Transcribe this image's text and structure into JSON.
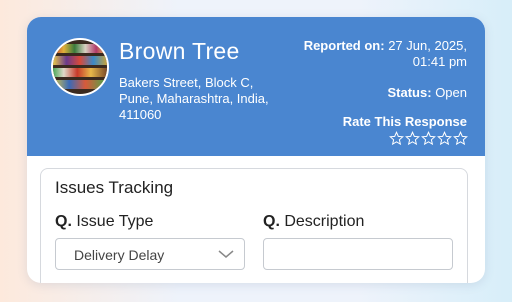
{
  "report": {
    "store_name": "Brown Tree",
    "address": "Bakers Street, Block C, Pune, Maharashtra, India, 411060",
    "reported_on_label": "Reported on:",
    "reported_on_value": "27 Jun, 2025, 01:41 pm",
    "status_label": "Status:",
    "status_value": "Open",
    "rate_label": "Rate This Response",
    "rating": 0,
    "rating_max": 5
  },
  "issues": {
    "title": "Issues Tracking",
    "q_prefix": "Q.",
    "issue_type_label": "Issue Type",
    "issue_type_value": "Delivery Delay",
    "description_label": "Description",
    "description_value": ""
  },
  "colors": {
    "header_bg": "#4a86d0",
    "accent_text": "#ffffff"
  }
}
